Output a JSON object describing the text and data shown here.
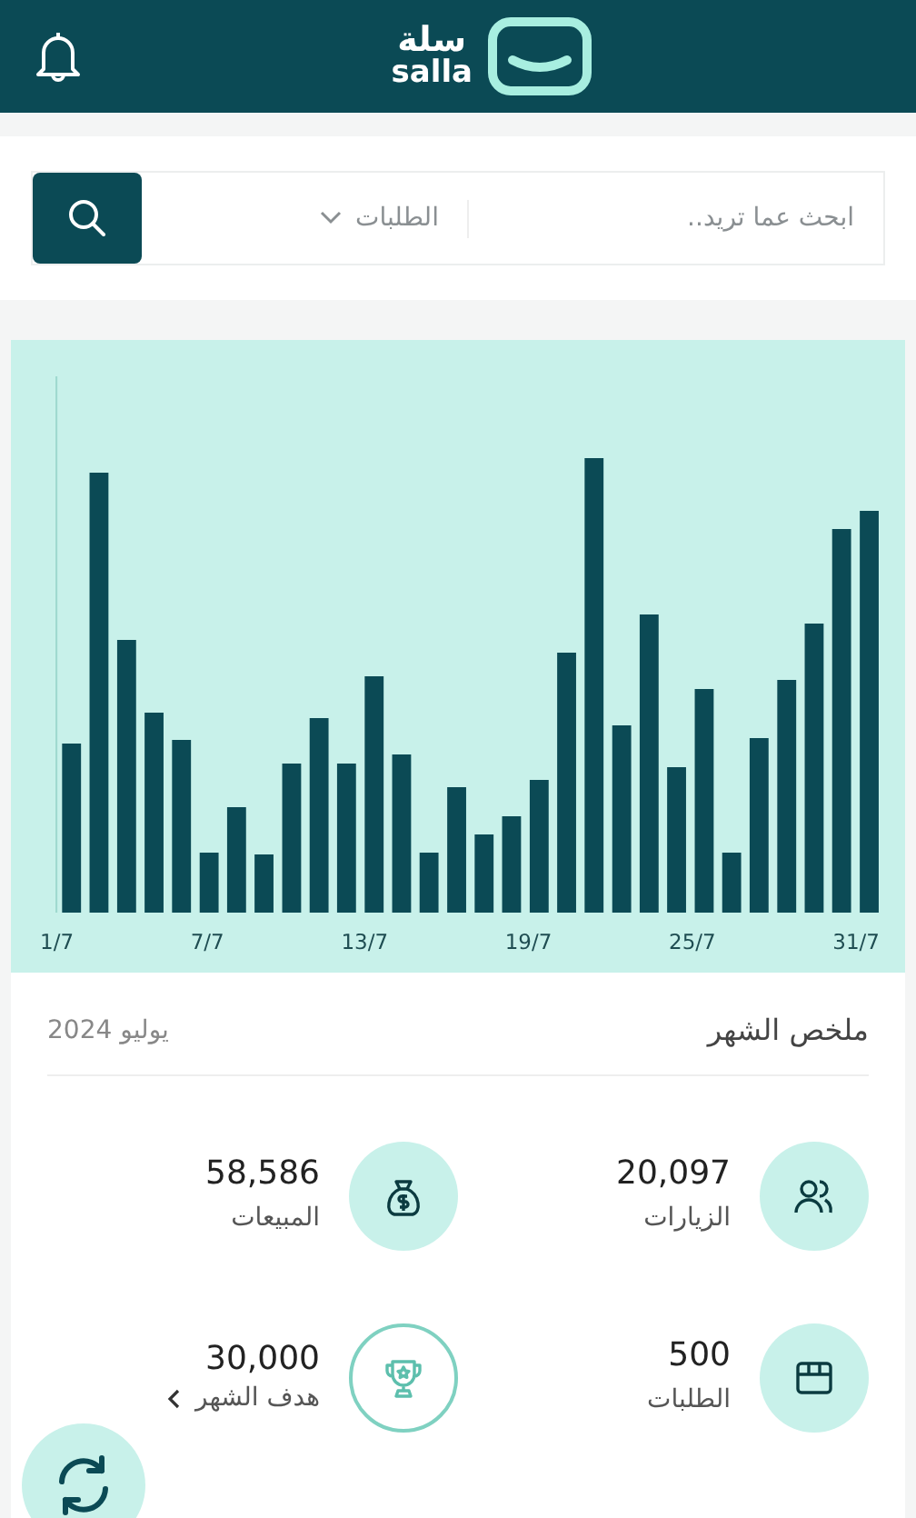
{
  "header": {
    "logo_arabic": "سلة",
    "logo_latin": "salla"
  },
  "search": {
    "placeholder": "ابحث عما تريد..",
    "scope": "الطلبات"
  },
  "chart": {
    "x_labels": [
      "31/7",
      "25/7",
      "19/7",
      "13/7",
      "7/7",
      "1/7"
    ]
  },
  "summary": {
    "title": "ملخص الشهر",
    "period": "يوليو 2024",
    "stats": [
      {
        "kind": "people",
        "value": "20,097",
        "label": "الزيارات",
        "link": false
      },
      {
        "kind": "money",
        "value": "58,586",
        "label": "المبيعات",
        "link": false
      },
      {
        "kind": "box",
        "value": "500",
        "label": "الطلبات",
        "link": false
      },
      {
        "kind": "trophy",
        "value": "30,000",
        "label": "هدف الشهر",
        "link": true
      }
    ]
  }
}
